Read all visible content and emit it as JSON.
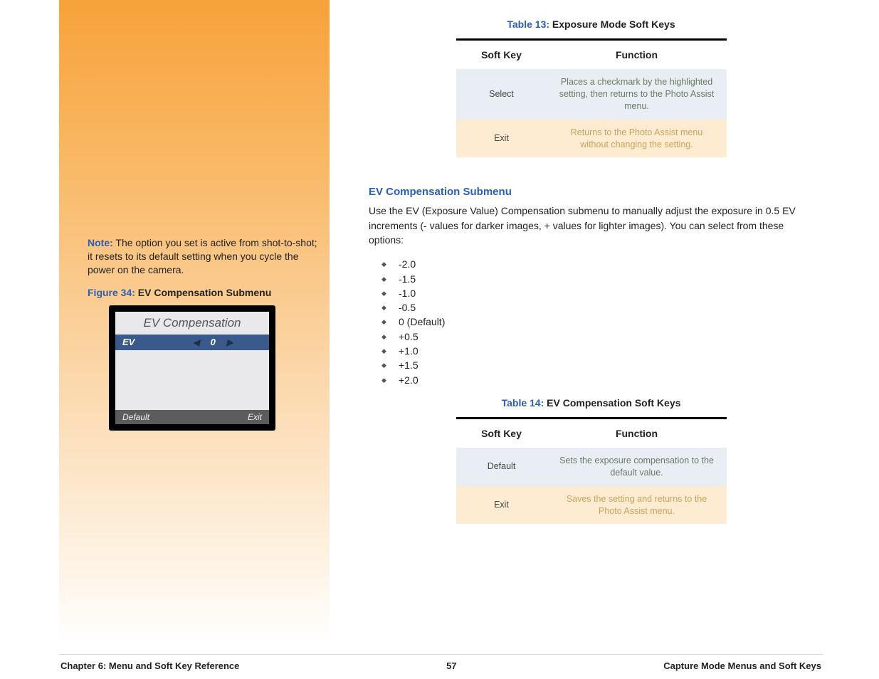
{
  "left": {
    "note_label": "Note:",
    "note_text": " The option you set is active from shot-to-shot; it resets to its default setting when you cycle the power on the camera.",
    "figure_label": "Figure 34:",
    "figure_title": " EV Compensation Submenu",
    "lcd": {
      "title": "EV Compensation",
      "row_label": "EV",
      "row_value": "0",
      "soft_left": "Default",
      "soft_right": "Exit"
    }
  },
  "table13": {
    "caption_label": "Table 13:",
    "caption_title": " Exposure Mode Soft Keys",
    "head_a": "Soft Key",
    "head_b": "Function",
    "rows": [
      {
        "a": "Select",
        "b": "Places a checkmark by the highlighted setting, then returns to the Photo Assist menu."
      },
      {
        "a": "Exit",
        "b": "Returns to the Photo Assist menu without changing the setting."
      }
    ]
  },
  "section": {
    "heading": "EV Compensation Submenu",
    "body": "Use the EV (Exposure Value) Compensation submenu to manually adjust the exposure in 0.5 EV increments (- values for darker images, + values for lighter images). You can select from these options:",
    "options": [
      "-2.0",
      "-1.5",
      "-1.0",
      "-0.5",
      "0 (Default)",
      "+0.5",
      "+1.0",
      "+1.5",
      "+2.0"
    ]
  },
  "table14": {
    "caption_label": "Table 14:",
    "caption_title": " EV Compensation Soft Keys",
    "head_a": "Soft Key",
    "head_b": "Function",
    "rows": [
      {
        "a": "Default",
        "b": "Sets the exposure compensation to the default value."
      },
      {
        "a": "Exit",
        "b": "Saves the setting and returns to the Photo Assist menu."
      }
    ]
  },
  "footer": {
    "left": "Chapter 6: Menu and Soft Key Reference",
    "center": "57",
    "right": "Capture Mode Menus and Soft Keys"
  }
}
